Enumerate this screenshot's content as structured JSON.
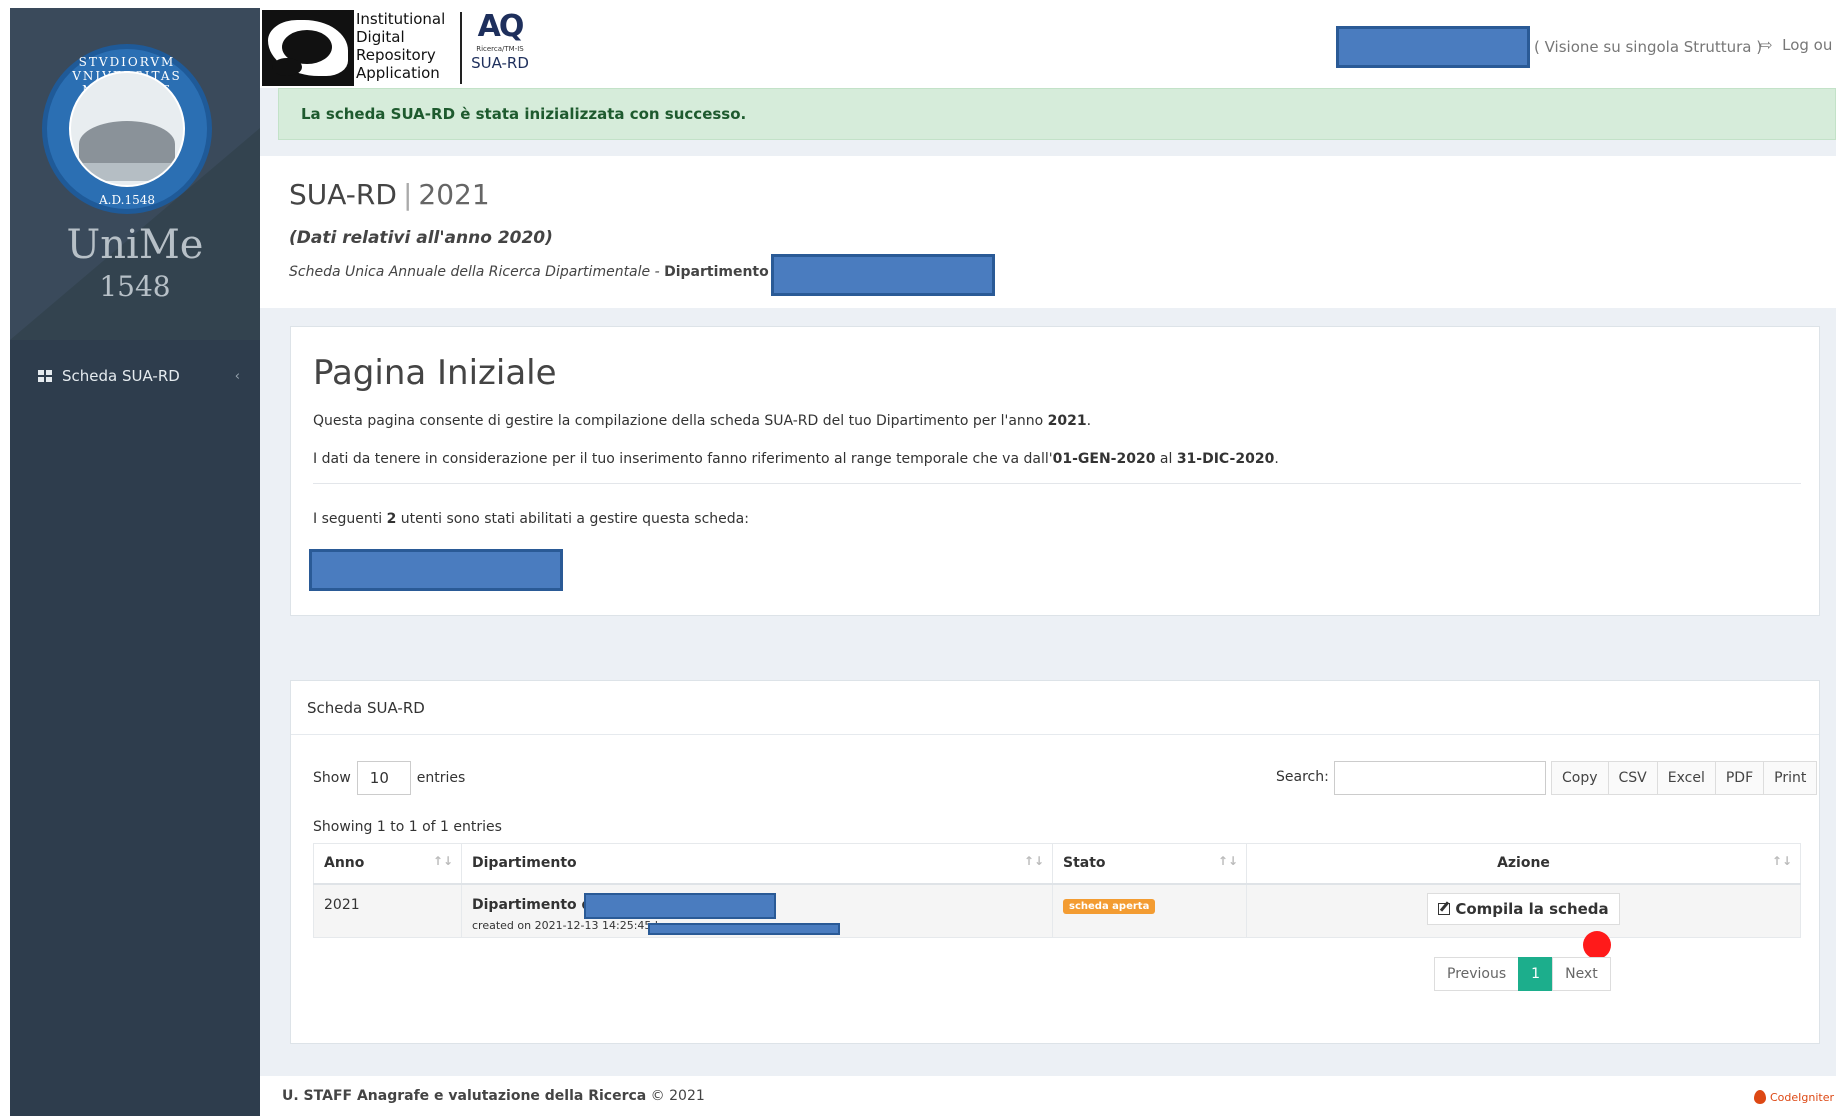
{
  "sidebar": {
    "seal_text": "STVDIORVM VNIVERSITAS MESSANAE",
    "seal_year": "A.D.1548",
    "brand_name": "UniMe",
    "brand_year": "1548",
    "menu_item_label": "Scheda SUA-RD",
    "menu_chevron": "‹"
  },
  "topbar": {
    "idra_lines": [
      "Institutional",
      "Digital",
      "Repository",
      "Application"
    ],
    "aq_mark": "AQ",
    "aq_small": "Ricerca/TM-IS",
    "aq_name": "SUA-RD",
    "visione": "( Visione su singola Struttura )",
    "logout": "Log ou"
  },
  "alert": {
    "message": "La scheda SUA-RD è stata inizializzata con successo."
  },
  "header": {
    "title": "SUA-RD",
    "separator": "|",
    "year": "2021",
    "subtitle": "(Dati relativi all'anno 2020)",
    "scheda_label": "Scheda Unica Annuale della Ricerca Dipartimentale - ",
    "dipartimento_label": "Dipartimento di"
  },
  "intro": {
    "heading": "Pagina Iniziale",
    "p1_prefix": "Questa pagina consente di gestire la compilazione della scheda SUA-RD del tuo Dipartimento per l'anno ",
    "p1_year": "2021",
    "p1_suffix": ".",
    "p2_prefix": "I dati da tenere in considerazione per il tuo inserimento fanno riferimento al range temporale che va dall'",
    "p2_from": "01-GEN-2020",
    "p2_mid": " al ",
    "p2_to": "31-DIC-2020",
    "p2_suffix": ".",
    "p3_prefix": "I seguenti ",
    "p3_count": "2",
    "p3_suffix": " utenti sono stati abilitati a gestire questa scheda:"
  },
  "table_box": {
    "title": "Scheda SUA-RD",
    "show_label": "Show",
    "show_value": "10",
    "entries_label": "entries",
    "search_label": "Search:",
    "search_value": "",
    "buttons": [
      "Copy",
      "CSV",
      "Excel",
      "PDF",
      "Print"
    ],
    "showing": "Showing 1 to 1 of 1 entries",
    "columns": [
      "Anno",
      "Dipartimento",
      "Stato",
      "Azione"
    ],
    "row": {
      "anno": "2021",
      "dipartimento": "Dipartimento di",
      "created": "created on 2021-12-13 14:25:45 by",
      "stato": "scheda aperta",
      "azione": "Compila la scheda"
    },
    "pager": {
      "previous": "Previous",
      "current": "1",
      "next": "Next"
    }
  },
  "footer": {
    "org": "U. STAFF Anagrafe e valutazione della Ricerca",
    "copy": " © 2021",
    "framework": "CodeIgniter"
  },
  "colors": {
    "sidebar": "#2e3d4d",
    "alert_bg": "#d6ecda",
    "redaction": "#4a7cbf",
    "badge": "#f39c32",
    "pager_active": "#1cae8c"
  }
}
